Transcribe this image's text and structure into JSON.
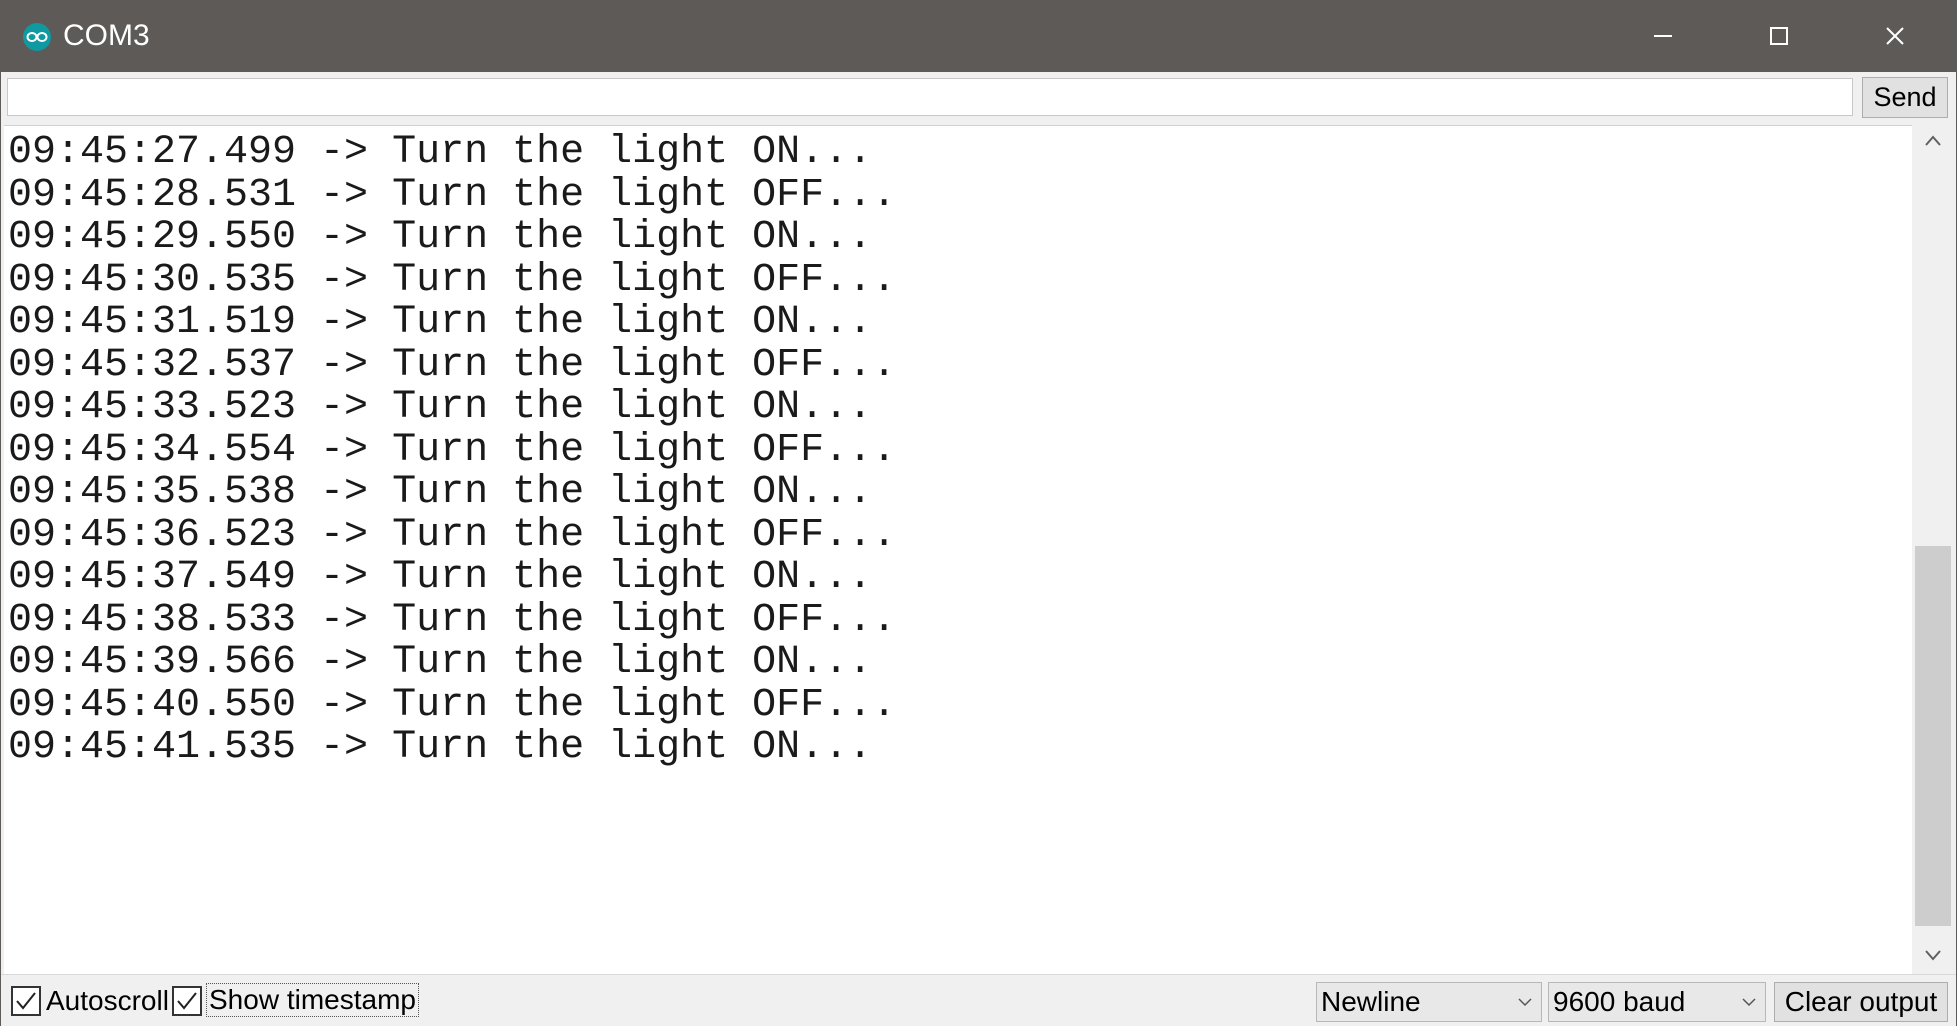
{
  "window": {
    "title": "COM3",
    "icon": "arduino-logo-icon",
    "controls": [
      "minimize-icon",
      "maximize-icon",
      "close-icon"
    ]
  },
  "send_bar": {
    "input_value": "",
    "input_placeholder": "",
    "send_label": "Send"
  },
  "output": {
    "lines": [
      "09:45:27.499 -> Turn the light ON...",
      "09:45:28.531 -> Turn the light OFF...",
      "09:45:29.550 -> Turn the light ON...",
      "09:45:30.535 -> Turn the light OFF...",
      "09:45:31.519 -> Turn the light ON...",
      "09:45:32.537 -> Turn the light OFF...",
      "09:45:33.523 -> Turn the light ON...",
      "09:45:34.554 -> Turn the light OFF...",
      "09:45:35.538 -> Turn the light ON...",
      "09:45:36.523 -> Turn the light OFF...",
      "09:45:37.549 -> Turn the light ON...",
      "09:45:38.533 -> Turn the light OFF...",
      "09:45:39.566 -> Turn the light ON...",
      "09:45:40.550 -> Turn the light OFF...",
      "09:45:41.535 -> Turn the light ON..."
    ]
  },
  "bottom_bar": {
    "autoscroll": {
      "label": "Autoscroll",
      "checked": true
    },
    "show_timestamp": {
      "label": "Show timestamp",
      "checked": true
    },
    "line_ending": {
      "selected": "Newline"
    },
    "baud_rate": {
      "selected": "9600 baud"
    },
    "clear_label": "Clear output"
  },
  "colors": {
    "titlebar": "#5d5a58",
    "accent": "#0e9aa0",
    "background": "#f0f0f0"
  }
}
